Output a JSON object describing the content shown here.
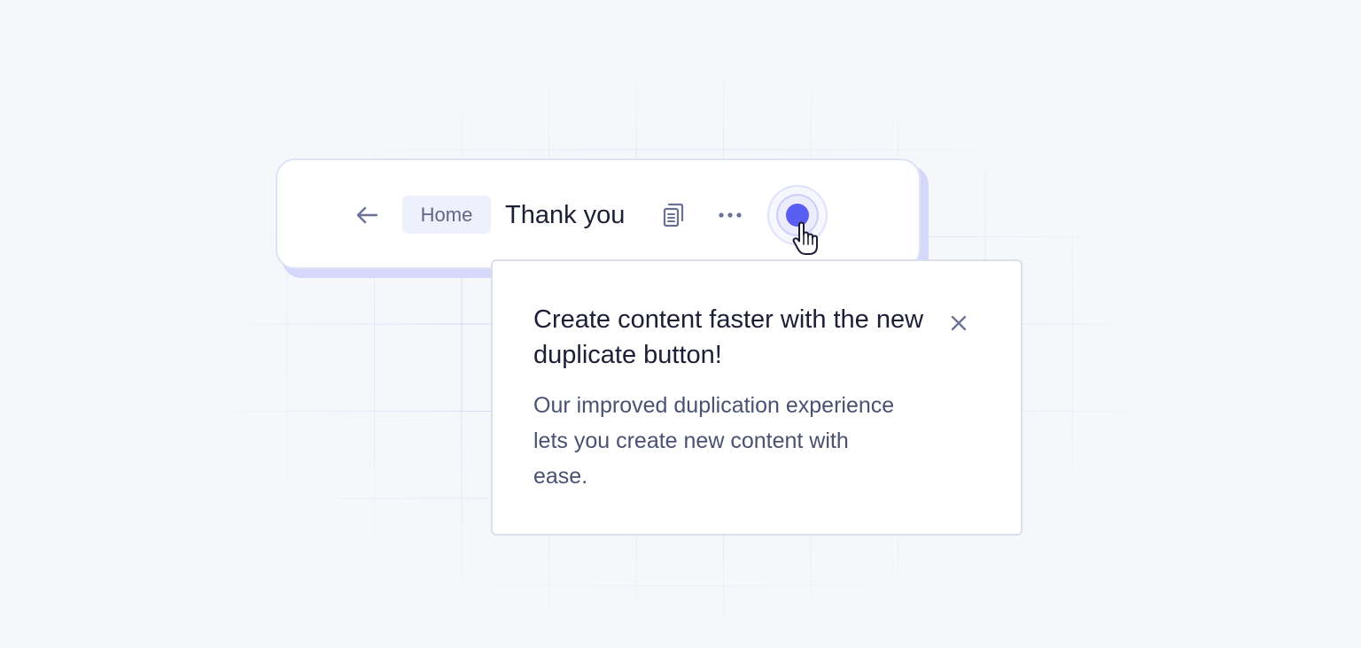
{
  "toolbar": {
    "back_icon": "arrow-left-icon",
    "breadcrumb_label": "Home",
    "page_title": "Thank you",
    "duplicate_icon": "duplicate-icon",
    "more_icon": "more-horizontal-icon",
    "hotspot_icon": "beacon-dot-icon"
  },
  "cursor_icon": "hand-pointer-icon",
  "popover": {
    "title": "Create content faster with the new duplicate button!",
    "body": "Our improved duplication experience lets you create new content with ease.",
    "close_icon": "close-icon"
  },
  "colors": {
    "accent": "#5a5ef0",
    "text_primary": "#1c1f35",
    "text_secondary": "#4a5172",
    "icon": "#6b7194",
    "background": "#f6f7fa"
  }
}
